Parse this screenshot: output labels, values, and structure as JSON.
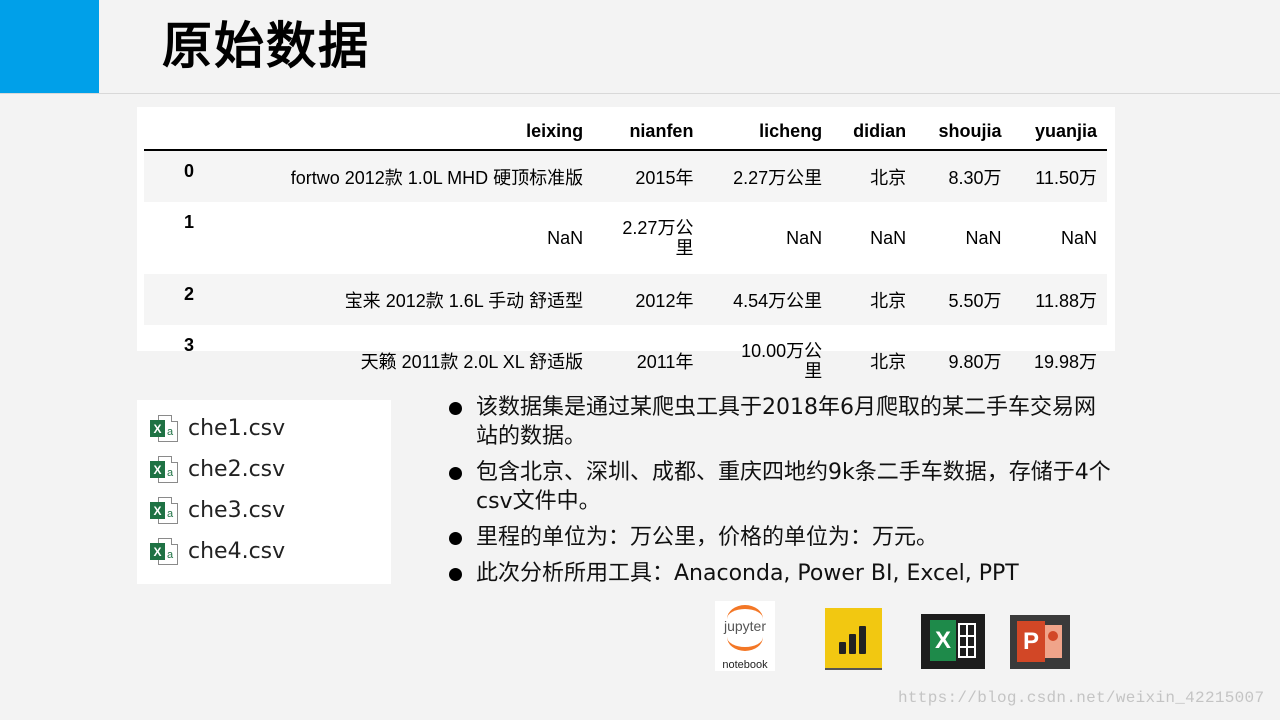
{
  "header": {
    "title": "原始数据",
    "accent_color": "#00a0e9"
  },
  "dataframe": {
    "columns": [
      "",
      "leixing",
      "nianfen",
      "licheng",
      "didian",
      "shoujia",
      "yuanjia"
    ],
    "rows": [
      [
        "0",
        "fortwo 2012款 1.0L MHD 硬顶标准版",
        "2015年",
        "2.27万公里",
        "北京",
        "8.30万",
        "11.50万"
      ],
      [
        "1",
        "NaN",
        "2.27万公里",
        "NaN",
        "NaN",
        "NaN",
        "NaN"
      ],
      [
        "2",
        "宝来 2012款 1.6L 手动 舒适型",
        "2012年",
        "4.54万公里",
        "北京",
        "5.50万",
        "11.88万"
      ],
      [
        "3",
        "天籁 2011款 2.0L XL 舒适版",
        "2011年",
        "10.00万公里",
        "北京",
        "9.80万",
        "19.98万"
      ]
    ]
  },
  "files": [
    {
      "name": "che1.csv",
      "icon": "excel-file-icon"
    },
    {
      "name": "che2.csv",
      "icon": "excel-file-icon"
    },
    {
      "name": "che3.csv",
      "icon": "excel-file-icon"
    },
    {
      "name": "che4.csv",
      "icon": "excel-file-icon"
    }
  ],
  "bullets": [
    "该数据集是通过某爬虫工具于2018年6月爬取的某二手车交易网站的数据。",
    "包含北京、深圳、成都、重庆四地约9k条二手车数据，存储于4个csv文件中。",
    "里程的单位为：万公里，价格的单位为：万元。",
    "此次分析所用工具：Anaconda, Power BI, Excel, PPT"
  ],
  "logos": {
    "jupyter_word": "jupyter",
    "jupyter_sub": "notebook",
    "excel_letter": "X",
    "ppt_letter": "P"
  },
  "watermark": "https://blog.csdn.net/weixin_42215007"
}
